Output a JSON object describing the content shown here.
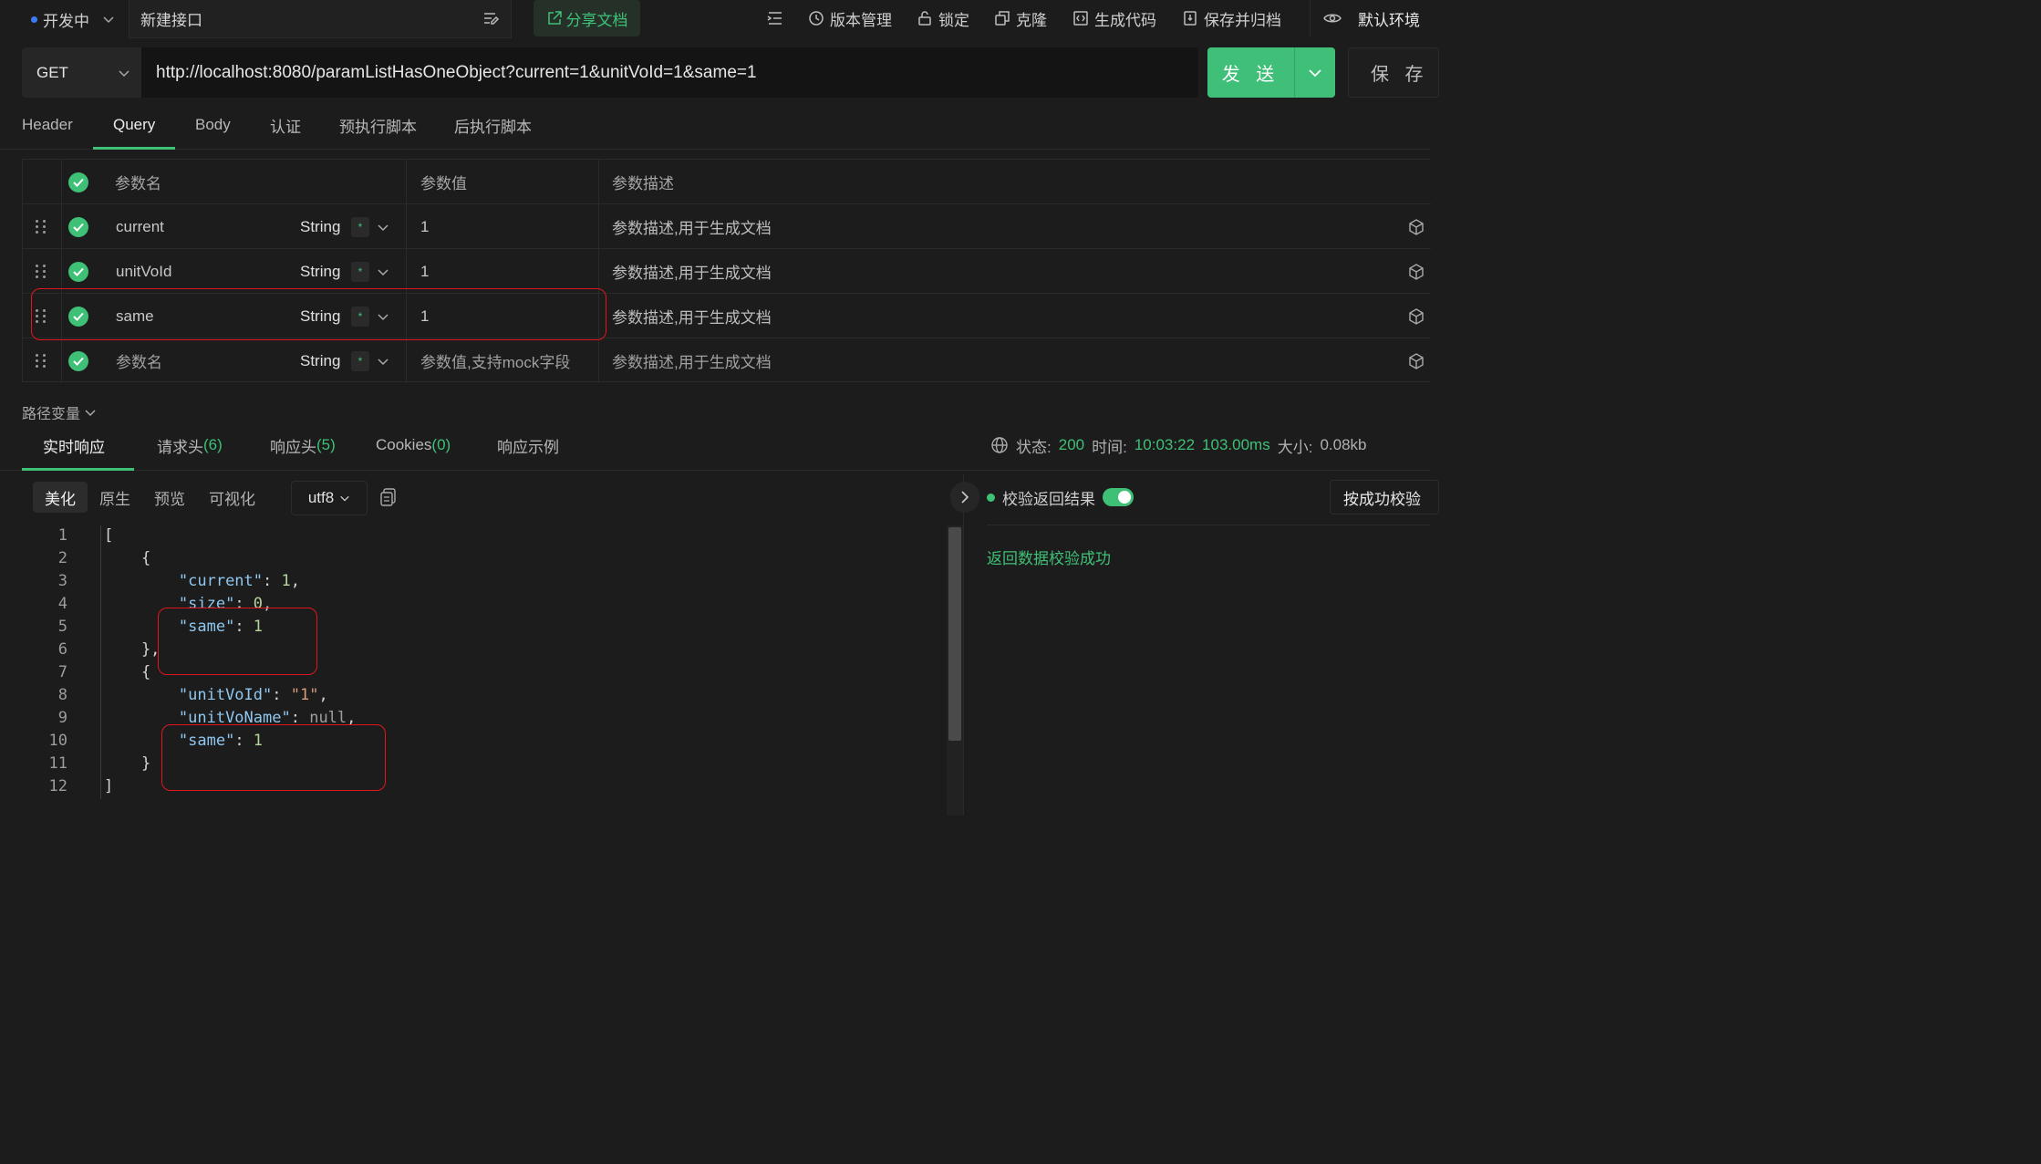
{
  "topbar": {
    "status": "开发中",
    "name_placeholder": "新建接口",
    "share": "分享文档",
    "tools": [
      "版本管理",
      "锁定",
      "克隆",
      "生成代码",
      "保存并归档"
    ],
    "environment": "默认环境"
  },
  "request": {
    "method": "GET",
    "url": "http://localhost:8080/paramListHasOneObject?current=1&unitVoId=1&same=1",
    "send_label": "发 送",
    "save_label": "保 存"
  },
  "request_tabs": [
    "Header",
    "Query",
    "Body",
    "认证",
    "预执行脚本",
    "后执行脚本"
  ],
  "params": {
    "headers": [
      "参数名",
      "参数值",
      "参数描述"
    ],
    "rows": [
      {
        "name": "current",
        "type": "String",
        "required": "*",
        "value": "1",
        "desc": "参数描述,用于生成文档"
      },
      {
        "name": "unitVoId",
        "type": "String",
        "required": "*",
        "value": "1",
        "desc": "参数描述,用于生成文档"
      },
      {
        "name": "same",
        "type": "String",
        "required": "*",
        "value": "1",
        "desc": "参数描述,用于生成文档"
      },
      {
        "name": "参数名",
        "type": "String",
        "required": "*",
        "value": "参数值,支持mock字段",
        "desc": "参数描述,用于生成文档"
      }
    ],
    "path_variables": "路径变量"
  },
  "response": {
    "tabs": [
      {
        "label": "实时响应",
        "count": ""
      },
      {
        "label": "请求头",
        "count": "(6)"
      },
      {
        "label": "响应头",
        "count": "(5)"
      },
      {
        "label": "Cookies",
        "count": "(0)"
      },
      {
        "label": "响应示例",
        "count": ""
      }
    ],
    "status_label": "状态:",
    "status": "200",
    "time_label": "时间:",
    "time": "10:03:22",
    "duration": "103.00ms",
    "size_label": "大小:",
    "size": "0.08kb",
    "views": [
      "美化",
      "原生",
      "预览",
      "可视化"
    ],
    "encoding": "utf8",
    "validate_label": "校验返回结果",
    "validate_mode": "按成功校验",
    "validate_result": "返回数据校验成功",
    "body_lines": [
      "[",
      "    {",
      "        \"current\": 1,",
      "        \"size\": 0,",
      "        \"same\": 1",
      "    },",
      "    {",
      "        \"unitVoId\": \"1\",",
      "        \"unitVoName\": null,",
      "        \"same\": 1",
      "    }",
      "]"
    ]
  },
  "colors": {
    "accent": "#3fc077",
    "highlight": "#e0161e",
    "background": "#1c1c1c"
  }
}
